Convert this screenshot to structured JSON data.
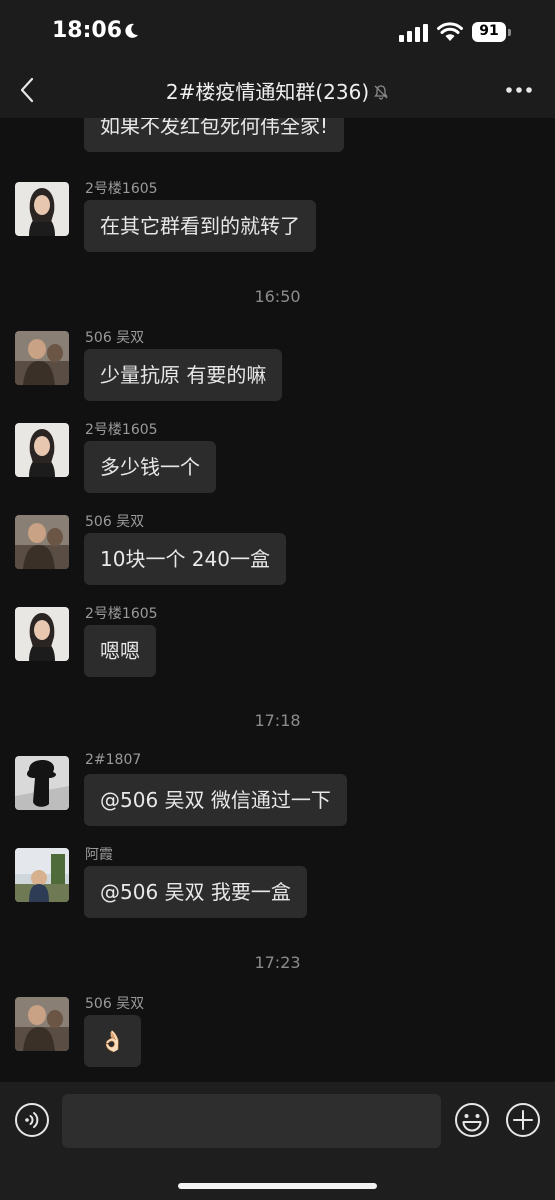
{
  "status_bar": {
    "time": "18:06",
    "battery": "91"
  },
  "header": {
    "title": "2#楼疫情通知群(236)"
  },
  "messages": [
    {
      "text": "如果不发红包死何伟全家!"
    },
    {
      "sender": "2号楼1605",
      "text": "在其它群看到的就转了"
    },
    {
      "timestamp": "16:50"
    },
    {
      "sender": "506 吴双",
      "text": "少量抗原 有要的嘛"
    },
    {
      "sender": "2号楼1605",
      "text": "多少钱一个"
    },
    {
      "sender": "506 吴双",
      "text": "10块一个 240一盒"
    },
    {
      "sender": "2号楼1605",
      "text": "嗯嗯"
    },
    {
      "timestamp": "17:18"
    },
    {
      "sender": "2#1807",
      "text": "@506 吴双 微信通过一下"
    },
    {
      "sender": "阿霞",
      "text": "@506 吴双 我要一盒"
    },
    {
      "timestamp": "17:23"
    },
    {
      "sender": "506 吴双",
      "text": "👌🏻"
    }
  ],
  "icons": {
    "back": "chevron-left-icon",
    "mute": "bell-slash-icon",
    "more": "more-dots-icon",
    "voice": "voice-icon",
    "emoji": "emoji-icon",
    "plus": "plus-icon"
  }
}
